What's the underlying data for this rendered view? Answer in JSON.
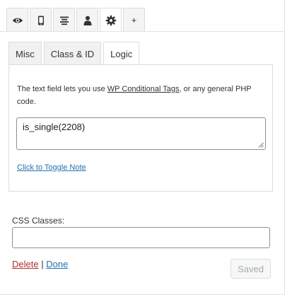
{
  "icon_tabs": [
    {
      "icon": "eye-icon"
    },
    {
      "icon": "mobile-icon"
    },
    {
      "icon": "align-center-icon"
    },
    {
      "icon": "user-icon"
    },
    {
      "icon": "gear-icon",
      "active": true
    },
    {
      "icon": "plus-icon",
      "label": "+"
    }
  ],
  "tabs": [
    {
      "label": "Misc"
    },
    {
      "label": "Class & ID"
    },
    {
      "label": "Logic",
      "active": true
    }
  ],
  "logic": {
    "description_before": "The text field lets you use ",
    "description_link": "WP Conditional Tags",
    "description_after": ", or any general PHP code.",
    "value": "is_single(2208)",
    "toggle_note": "Click to Toggle Note"
  },
  "css_classes": {
    "label": "CSS Classes:",
    "value": ""
  },
  "actions": {
    "delete": "Delete",
    "separator": "|",
    "done": "Done",
    "saved": "Saved"
  },
  "colors": {
    "link": "#2271b1",
    "delete": "#b32d2e",
    "disabled_text": "#a7aaad"
  }
}
